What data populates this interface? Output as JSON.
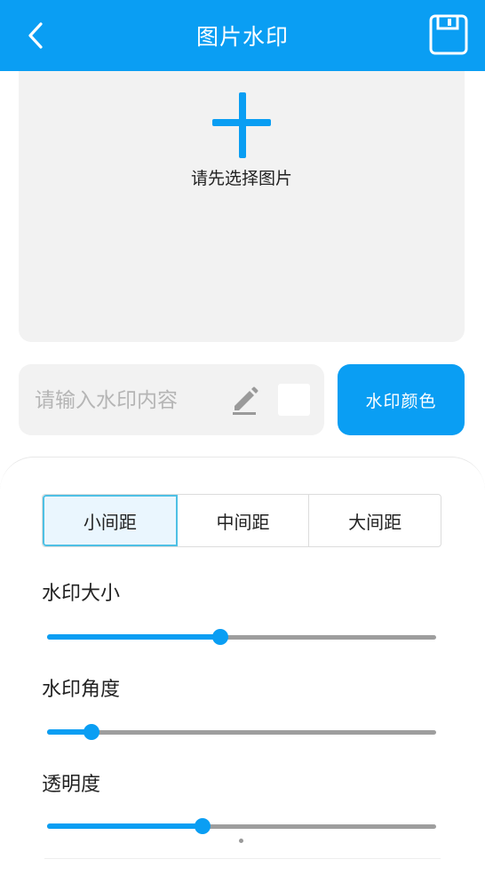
{
  "header": {
    "title": "图片水印",
    "back_icon": "chevron-left-icon",
    "save_icon": "floppy-disk-icon",
    "color": "#0a9ef3"
  },
  "picker": {
    "icon": "plus-icon",
    "hint": "请先选择图片"
  },
  "watermark_input": {
    "value": "",
    "placeholder": "请输入水印内容",
    "edit_icon": "pencil-icon",
    "swatch_color": "#ffffff"
  },
  "color_button": {
    "label": "水印颜色"
  },
  "spacing": {
    "options": [
      "小间距",
      "中间距",
      "大间距"
    ],
    "selected": "小间距"
  },
  "sliders": [
    {
      "label": "水印大小",
      "value": 0.445
    },
    {
      "label": "水印角度",
      "value": 0.114
    },
    {
      "label": "透明度",
      "value": 0.4
    }
  ]
}
